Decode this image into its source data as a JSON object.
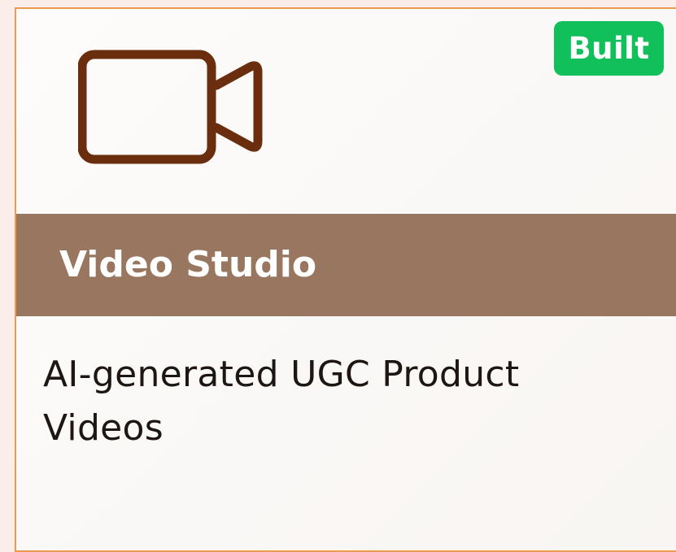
{
  "card": {
    "status_badge": "Built",
    "title": "Video Studio",
    "description": "AI-generated UGC Product Videos",
    "icon": "video-camera-icon"
  },
  "colors": {
    "border": "#ec9a4e",
    "badge_bg": "#11c05a",
    "title_band": "#99765f",
    "icon_stroke": "#6a2d0d",
    "description_text": "#1e1612"
  }
}
